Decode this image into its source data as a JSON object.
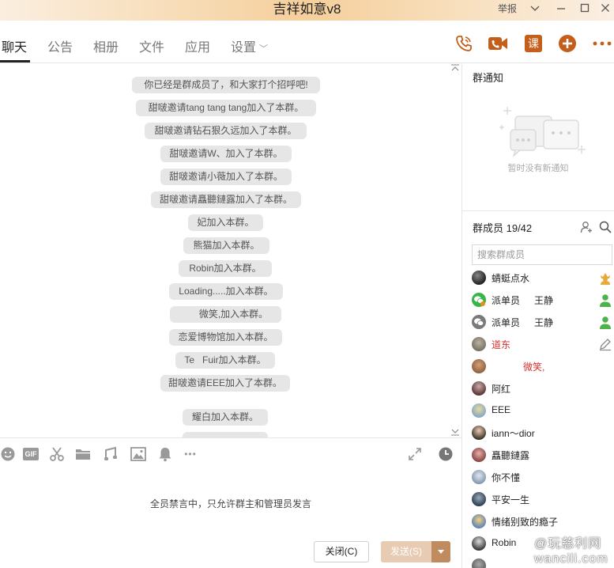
{
  "window": {
    "title": "吉祥如意v8",
    "report": "举报"
  },
  "nav": {
    "tabs": [
      {
        "label": "聊天"
      },
      {
        "label": "公告"
      },
      {
        "label": "相册"
      },
      {
        "label": "文件"
      },
      {
        "label": "应用"
      },
      {
        "label": "设置"
      }
    ],
    "icons": [
      "phone-icon",
      "video-icon",
      "course-icon",
      "add-icon",
      "more-icon"
    ],
    "course_glyph": "课"
  },
  "chat": {
    "messages": [
      "你已经是群成员了，和大家打个招呼吧!",
      "甜啵邀请tang tang tang加入了本群。",
      "甜啵邀请钻石狠久远加入了本群。",
      "甜啵邀请W、加入了本群。",
      "甜啵邀请小薇加入了本群。",
      "甜啵邀请矗聽鏈露加入了本群。",
      "妃加入本群。",
      "熊猫加入本群。",
      "Robin加入本群。",
      "Loading.....加入本群。",
      "      微笑,加入本群。",
      "恋爱博物馆加入本群。",
      "Te   Fuir加入本群。",
      "甜啵邀请EEE加入了本群。",
      "耀白加入本群。"
    ]
  },
  "toolbar": {
    "gif": "GIF",
    "more": "•••"
  },
  "compose": {
    "mute_notice": "全员禁言中，只允许群主和管理员发言",
    "close_label": "关闭(C)",
    "send_label": "发送(S)"
  },
  "notice": {
    "title": "群通知",
    "empty": "暂时没有新通知"
  },
  "members": {
    "title": "群成员 19/42",
    "search_placeholder": "搜索群成员",
    "list": [
      {
        "name": "蜻蜓点水",
        "badge": ""
      },
      {
        "name": "派单员",
        "badge": "王静"
      },
      {
        "name": "派单员",
        "badge": "王静"
      },
      {
        "name": "道东",
        "badge": ""
      },
      {
        "name": "            微笑,",
        "badge": ""
      },
      {
        "name": "阿红",
        "badge": ""
      },
      {
        "name": "EEE",
        "badge": ""
      },
      {
        "name": "iann～dior",
        "badge": ""
      },
      {
        "name": "矗聽鏈露",
        "badge": ""
      },
      {
        "name": "你不懂",
        "badge": ""
      },
      {
        "name": "平安一生",
        "badge": ""
      },
      {
        "name": "情绪别致的瘾子",
        "badge": ""
      },
      {
        "name": "Robin",
        "badge": ""
      }
    ]
  },
  "watermark": {
    "line1": "@玩慈利网",
    "line2": "wancili.com"
  }
}
